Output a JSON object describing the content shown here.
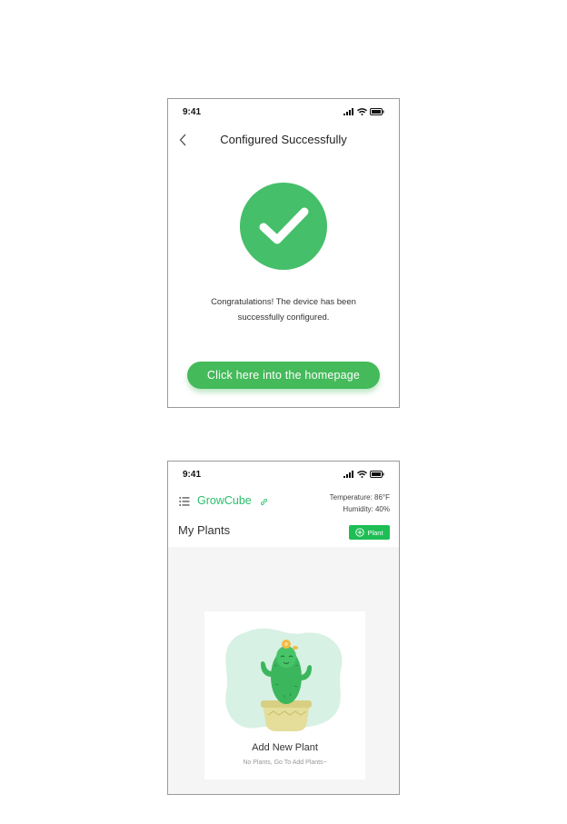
{
  "screen_success": {
    "status_time": "9:41",
    "nav_title": "Configured Successfully",
    "message_line1": "Congratulations! The device has been",
    "message_line2": "successfully configured.",
    "button_label": "Click here into the homepage"
  },
  "screen_home": {
    "status_time": "9:41",
    "brand": "GrowCube",
    "temperature": "Temperature: 86°F",
    "humidity": "Humidity: 40%",
    "section_title": "My Plants",
    "add_button_label": "Plant",
    "empty_title": "Add New Plant",
    "empty_subtitle": "No Plants, Go To Add Plants~"
  },
  "icons": {
    "back": "chevron-left-icon",
    "check": "checkmark-icon",
    "menu": "list-menu-icon",
    "link": "link-icon",
    "add": "plus-circle-icon",
    "signal": "cellular-signal-icon",
    "wifi": "wifi-icon",
    "battery": "battery-icon"
  },
  "colors": {
    "success_green": "#45bf6a",
    "button_green": "#44ba5a",
    "brand_green": "#27c06a",
    "add_button_green": "#1fbe55",
    "content_background": "#f5f5f5"
  }
}
